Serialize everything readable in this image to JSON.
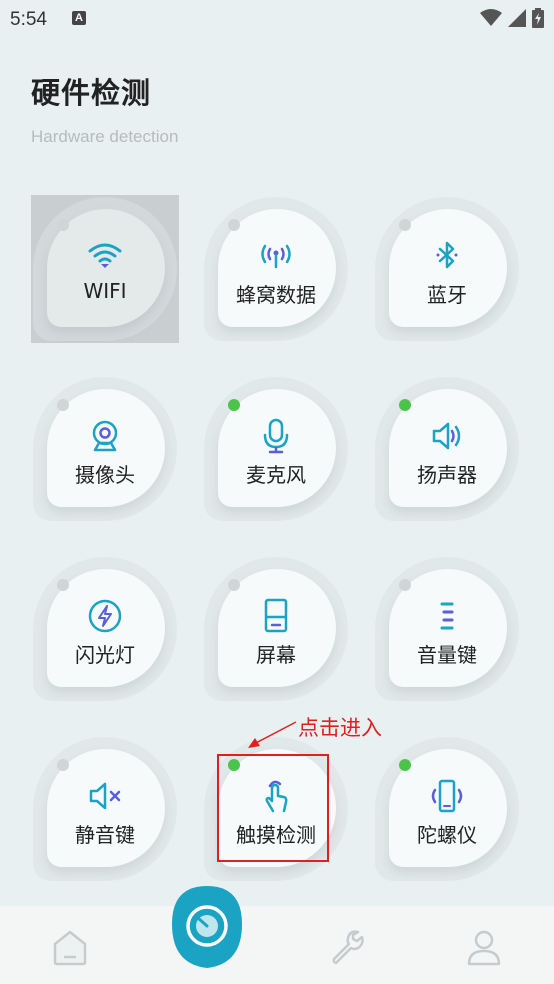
{
  "status_bar": {
    "time": "5:54",
    "notification_glyph": "A"
  },
  "header": {
    "title": "硬件检测",
    "subtitle": "Hardware detection"
  },
  "tiles": [
    {
      "label": "WIFI",
      "icon": "wifi-icon",
      "active": false,
      "selected": true
    },
    {
      "label": "蜂窝数据",
      "icon": "cellular-icon",
      "active": false,
      "selected": false
    },
    {
      "label": "蓝牙",
      "icon": "bluetooth-icon",
      "active": false,
      "selected": false
    },
    {
      "label": "摄像头",
      "icon": "camera-icon",
      "active": false,
      "selected": false
    },
    {
      "label": "麦克风",
      "icon": "microphone-icon",
      "active": true,
      "selected": false
    },
    {
      "label": "扬声器",
      "icon": "speaker-icon",
      "active": true,
      "selected": false
    },
    {
      "label": "闪光灯",
      "icon": "flash-icon",
      "active": false,
      "selected": false
    },
    {
      "label": "屏幕",
      "icon": "screen-icon",
      "active": false,
      "selected": false
    },
    {
      "label": "音量键",
      "icon": "volume-key-icon",
      "active": false,
      "selected": false
    },
    {
      "label": "静音键",
      "icon": "mute-icon",
      "active": false,
      "selected": false
    },
    {
      "label": "触摸检测",
      "icon": "touch-icon",
      "active": true,
      "selected": false
    },
    {
      "label": "陀螺仪",
      "icon": "gyroscope-icon",
      "active": true,
      "selected": false
    }
  ],
  "annotation": {
    "text": "点击进入"
  },
  "bottom_nav": [
    {
      "icon": "home-icon"
    },
    {
      "icon": "detect-icon"
    },
    {
      "icon": "wrench-icon"
    },
    {
      "icon": "profile-icon"
    }
  ],
  "colors": {
    "accent": "#1aa3c2",
    "active_dot": "#4cc44c",
    "annotation": "#e02020"
  }
}
